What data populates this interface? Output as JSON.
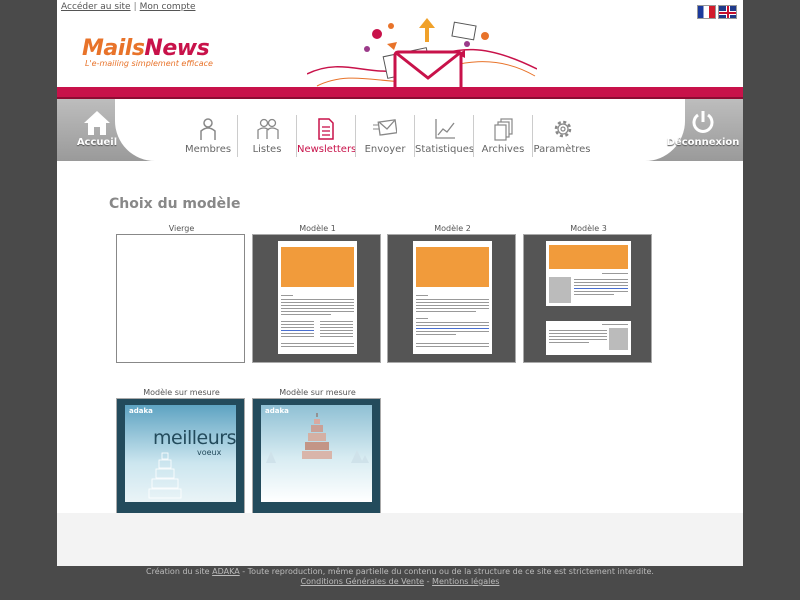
{
  "header": {
    "links": {
      "access_site": "Accéder au site",
      "separator": "|",
      "my_account": "Mon compte"
    },
    "logo": {
      "part1": "Mails",
      "part2": "News",
      "tagline": "L'e-mailing simplement efficace"
    },
    "flags": [
      "fr",
      "uk"
    ]
  },
  "nav": {
    "home": "Accueil",
    "logout": "Déconnexion",
    "items": [
      {
        "label": "Membres",
        "icon": "person-icon"
      },
      {
        "label": "Listes",
        "icon": "people-icon"
      },
      {
        "label": "Newsletters",
        "icon": "document-icon",
        "active": true
      },
      {
        "label": "Envoyer",
        "icon": "envelope-icon"
      },
      {
        "label": "Statistiques",
        "icon": "chart-icon"
      },
      {
        "label": "Archives",
        "icon": "archive-icon"
      },
      {
        "label": "Paramètres",
        "icon": "gear-icon"
      }
    ],
    "active_color": "#c8124a"
  },
  "main": {
    "title": "Choix du modèle",
    "templates": [
      {
        "label": "Vierge",
        "type": "blank"
      },
      {
        "label": "Modèle 1",
        "type": "model1"
      },
      {
        "label": "Modèle 2",
        "type": "model2"
      },
      {
        "label": "Modèle 3",
        "type": "model3"
      },
      {
        "label": "Modèle sur mesure",
        "type": "custom1",
        "art_text": "meilleurs",
        "art_sub": "voeux",
        "brand": "adaka"
      },
      {
        "label": "Modèle sur mesure",
        "type": "custom2",
        "brand": "adaka"
      }
    ]
  },
  "footer": {
    "line1_prefix": "Création du site",
    "line1_link": "ADAKA",
    "line1_suffix": "- Toute reproduction, même partielle du contenu ou de la structure de ce site est strictement interdite.",
    "terms": "Conditions Générales de Vente",
    "dash": "-",
    "legal": "Mentions légales"
  },
  "colors": {
    "brand_orange": "#e8732a",
    "brand_pink": "#c8124a"
  }
}
